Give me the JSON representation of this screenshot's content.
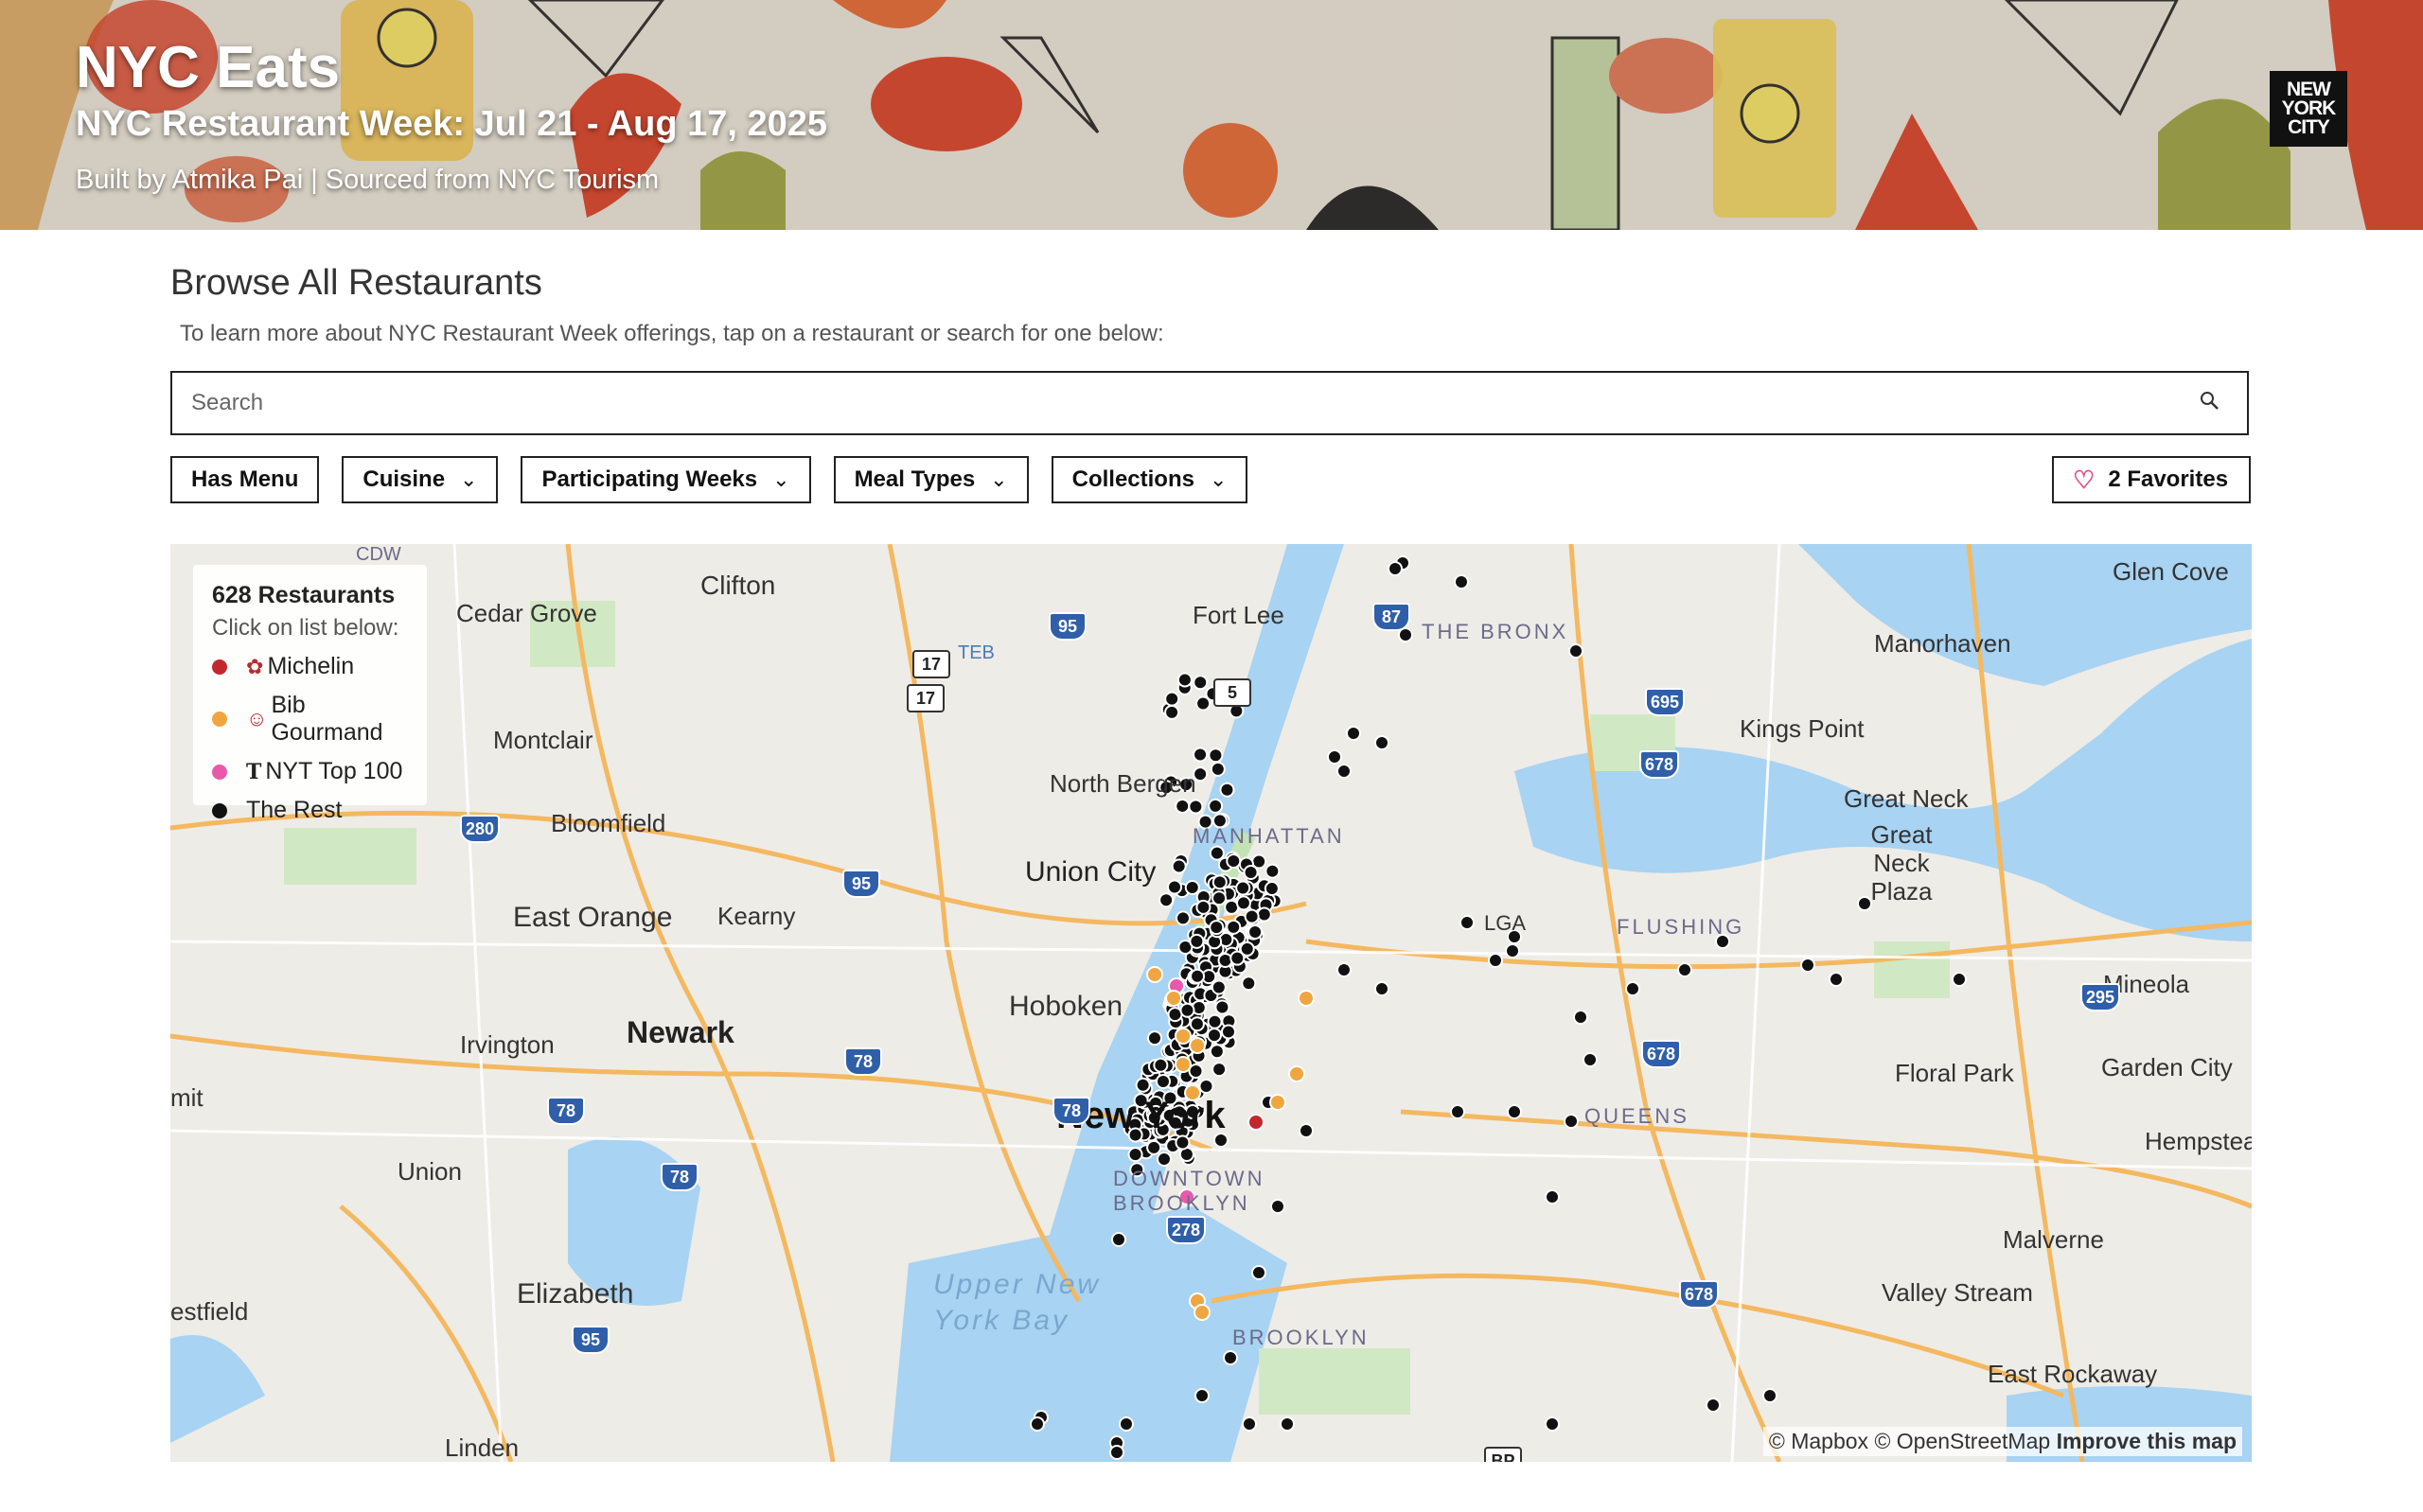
{
  "banner": {
    "title": "NYC Eats",
    "subtitle": "NYC Restaurant Week: Jul 21 - Aug 17, 2025",
    "credit": "Built by Atmika Pai | Sourced from NYC Tourism",
    "logo_lines": [
      "NEW",
      "YORK",
      "CITY"
    ]
  },
  "browse": {
    "title": "Browse All Restaurants",
    "subtitle": "To learn more about NYC Restaurant Week offerings, tap on a restaurant or search for one below:"
  },
  "search": {
    "placeholder": "Search",
    "icon": "search-icon"
  },
  "filters": {
    "has_menu": "Has Menu",
    "cuisine": "Cuisine",
    "participating_weeks": "Participating Weeks",
    "meal_types": "Meal Types",
    "collections": "Collections",
    "favorites": "2 Favorites"
  },
  "legend": {
    "count": "628 Restaurants",
    "hint": "Click on list below:",
    "items": [
      {
        "label": "Michelin",
        "color": "#c0282d",
        "symbol": "michelin-flower-icon"
      },
      {
        "label": "Bib Gourmand",
        "color": "#f0a640",
        "symbol": "bib-gourmand-icon"
      },
      {
        "label": "NYT Top 100",
        "color": "#e85aa9",
        "symbol": "nyt-icon"
      },
      {
        "label": "The Rest",
        "color": "#111111",
        "symbol": ""
      }
    ]
  },
  "map": {
    "labels": {
      "clifton": "Clifton",
      "cedar_grove": "Cedar Grove",
      "fort_lee": "Fort Lee",
      "the_bronx": "THE BRONX",
      "glen_cove": "Glen Cove",
      "manorhaven": "Manorhaven",
      "kings_point": "Kings Point",
      "great_neck": "Great Neck",
      "great_neck_plaza": "Great Neck Plaza",
      "montclair": "Montclair",
      "north_bergen": "North Bergen",
      "bloomfield": "Bloomfield",
      "union_city": "Union City",
      "manhattan": "MANHATTAN",
      "east_orange": "East Orange",
      "kearny": "Kearny",
      "lga": "LGA",
      "flushing": "FLUSHING",
      "mineola": "Mineola",
      "hoboken": "Hoboken",
      "newark": "Newark",
      "irvington": "Irvington",
      "floral_park": "Floral Park",
      "garden_city": "Garden City",
      "new_york": "New York",
      "queens": "QUEENS",
      "mit": "mit",
      "union": "Union",
      "hempstead": "Hempstea",
      "downtown_brooklyn": "DOWNTOWN BROOKLYN",
      "malverne": "Malverne",
      "elizabeth": "Elizabeth",
      "upper_bay": "Upper New York Bay",
      "valley_stream": "Valley Stream",
      "estfield": "estfield",
      "brooklyn": "BROOKLYN",
      "east_rockaway": "East Rockaway",
      "linden": "Linden",
      "teb": "TEB",
      "cdw": "CDW"
    },
    "highways": [
      "17",
      "17",
      "95",
      "87",
      "5",
      "695",
      "678",
      "280",
      "95",
      "295",
      "678",
      "78",
      "78",
      "78",
      "78",
      "278",
      "678",
      "95",
      "BP"
    ],
    "attribution": {
      "mapbox": "© Mapbox",
      "osm": "© OpenStreetMap",
      "improve": "Improve this map"
    }
  }
}
